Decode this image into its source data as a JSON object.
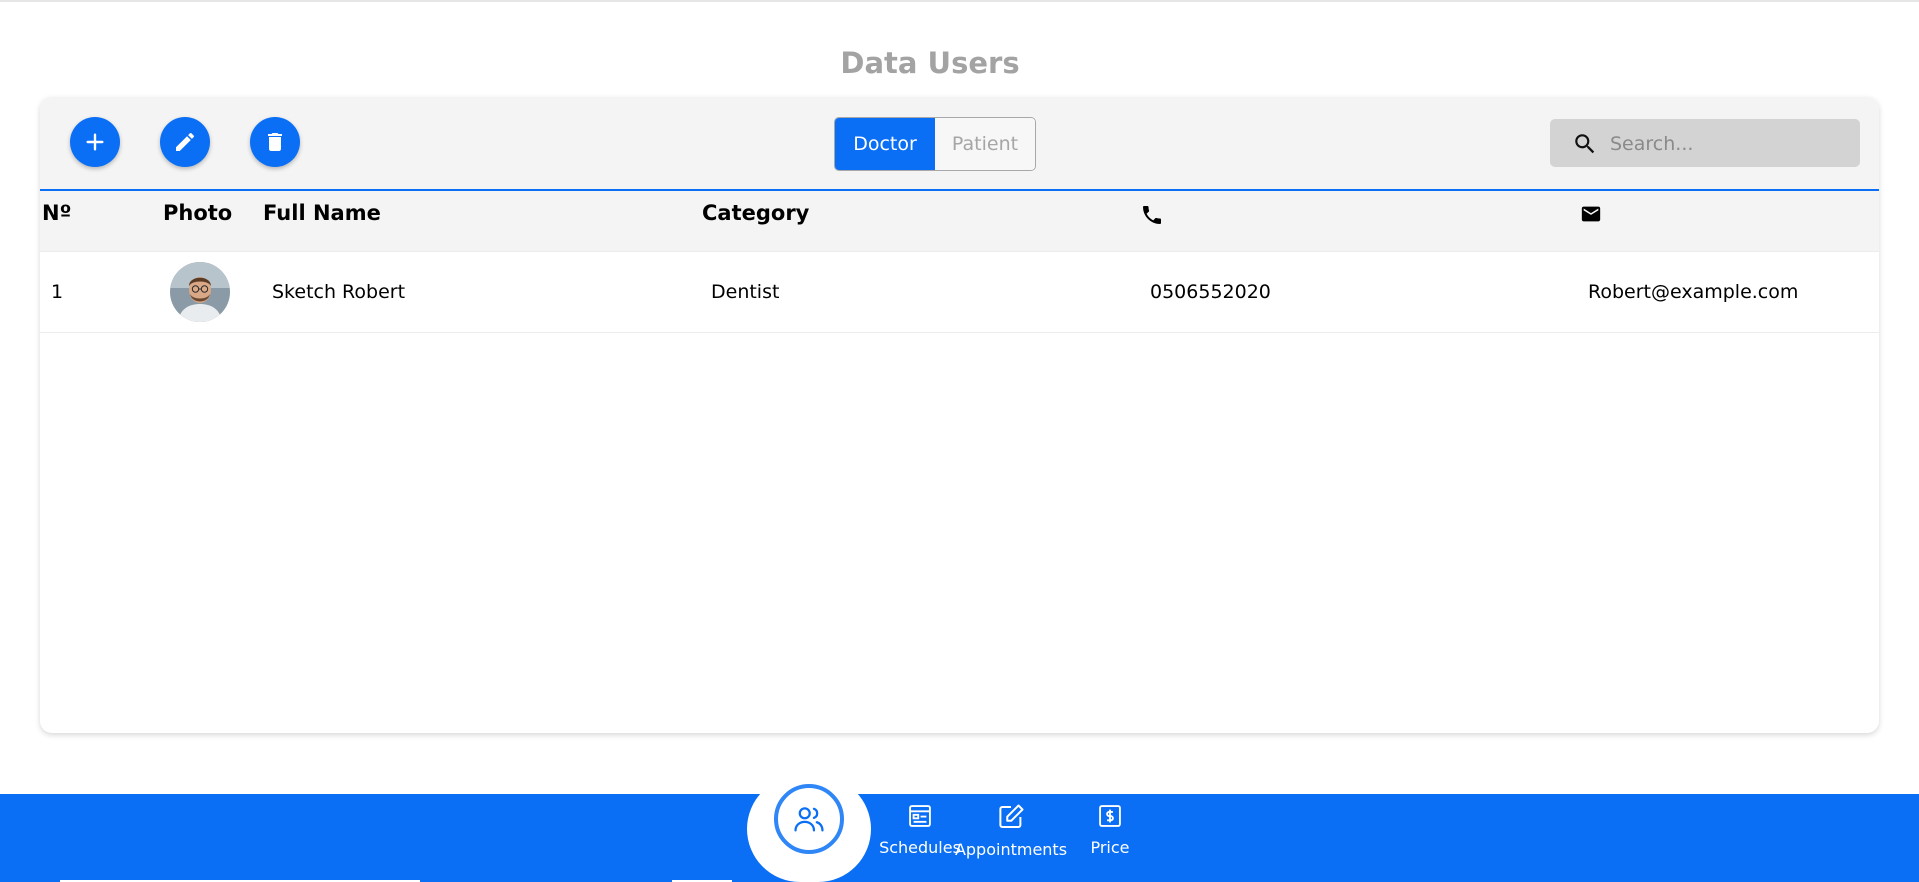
{
  "page": {
    "title": "Data Users"
  },
  "toolbar": {
    "add_icon": "plus-icon",
    "edit_icon": "pencil-icon",
    "delete_icon": "trash-icon",
    "segments": [
      {
        "label": "Doctor",
        "active": true
      },
      {
        "label": "Patient",
        "active": false
      }
    ],
    "search": {
      "placeholder": "Search...",
      "value": "",
      "icon": "search-icon"
    }
  },
  "table": {
    "headers": {
      "number": "Nº",
      "photo": "Photo",
      "full_name": "Full Name",
      "category": "Category",
      "phone_icon": "phone-icon",
      "email_icon": "mail-icon"
    },
    "rows": [
      {
        "number": "1",
        "photo": "avatar",
        "full_name": "Sketch Robert",
        "category": "Dentist",
        "phone": "0506552020",
        "email": "Robert@example.com"
      }
    ]
  },
  "bottom_nav": {
    "active_icon": "users-icon",
    "items": [
      {
        "label": "Schedules",
        "icon": "schedule-icon"
      },
      {
        "label": "Appointments",
        "icon": "edit-note-icon"
      },
      {
        "label": "Price",
        "icon": "dollar-icon"
      }
    ]
  },
  "colors": {
    "accent": "#0a6ff5",
    "title": "#a3a3a3",
    "toolbar_bg": "#f4f4f4",
    "search_bg": "#d3d3d3"
  }
}
